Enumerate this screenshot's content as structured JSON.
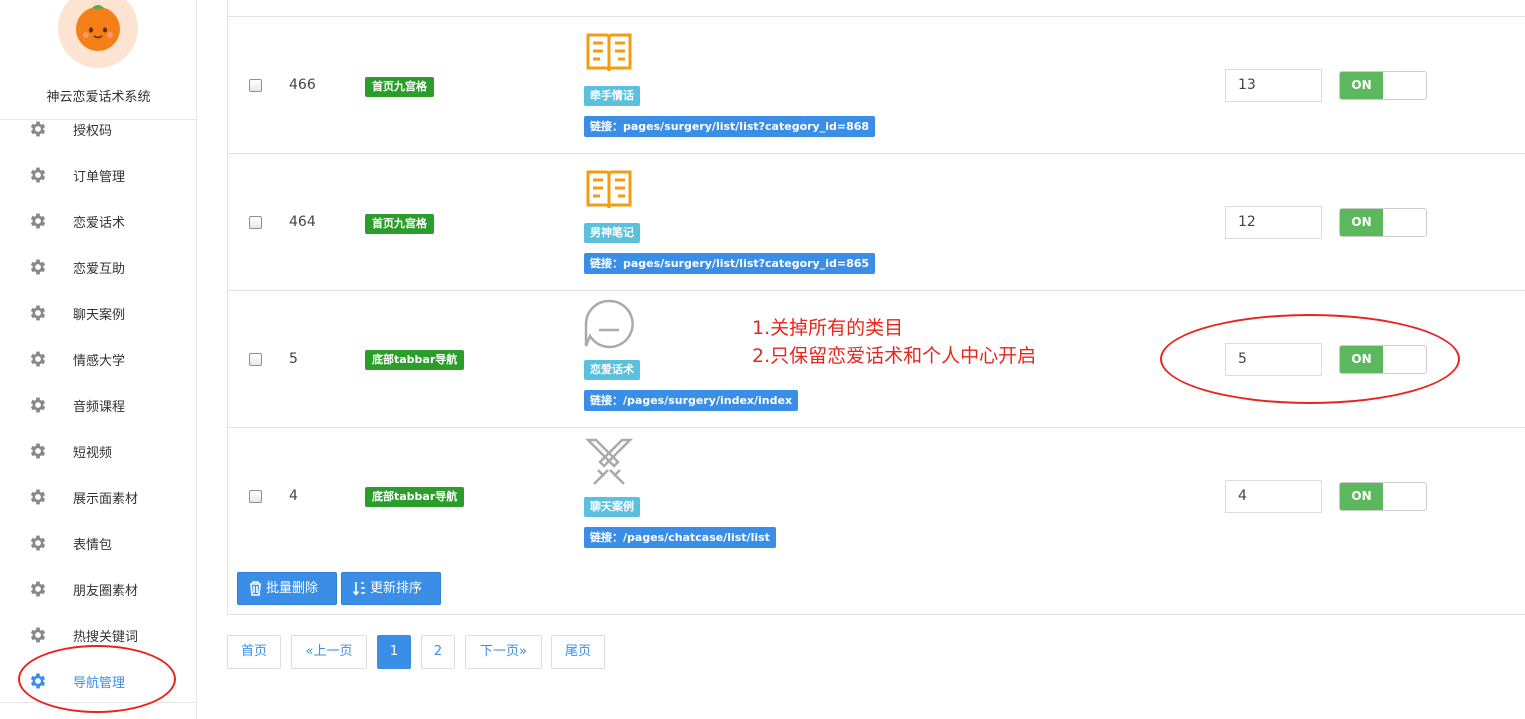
{
  "brand": {
    "name": "神云恋爱话术系统"
  },
  "sidebar": {
    "items": [
      {
        "label": "授权码",
        "icon": "gear-icon"
      },
      {
        "label": "订单管理",
        "icon": "gear-icon"
      },
      {
        "label": "恋爱话术",
        "icon": "gear-icon"
      },
      {
        "label": "恋爱互助",
        "icon": "gear-icon"
      },
      {
        "label": "聊天案例",
        "icon": "gear-icon"
      },
      {
        "label": "情感大学",
        "icon": "gear-icon"
      },
      {
        "label": "音频课程",
        "icon": "gear-icon"
      },
      {
        "label": "短视频",
        "icon": "gear-icon"
      },
      {
        "label": "展示面素材",
        "icon": "gear-icon"
      },
      {
        "label": "表情包",
        "icon": "gear-icon"
      },
      {
        "label": "朋友圈素材",
        "icon": "gear-icon"
      },
      {
        "label": "热搜关键词",
        "icon": "gear-icon"
      },
      {
        "label": "导航管理",
        "icon": "gear-icon",
        "active": true
      }
    ],
    "active_color": "#3a8ee6"
  },
  "table": {
    "rows": [
      {
        "id": "466",
        "type": "首页九宫格",
        "icon": "book-icon",
        "name": "牵手情话",
        "link": "链接：pages/surgery/list/list?category_id=868",
        "sort": "13",
        "switch": "ON"
      },
      {
        "id": "464",
        "type": "首页九宫格",
        "icon": "book-icon",
        "name": "男神笔记",
        "link": "链接：pages/surgery/list/list?category_id=865",
        "sort": "12",
        "switch": "ON"
      },
      {
        "id": "5",
        "type": "底部tabbar导航",
        "icon": "chat-bubble-icon",
        "name": "恋爱话术",
        "link": "链接：/pages/surgery/index/index",
        "sort": "5",
        "switch": "ON"
      },
      {
        "id": "4",
        "type": "底部tabbar导航",
        "icon": "crossed-swords-icon",
        "name": "聊天案例",
        "link": "链接：/pages/chatcase/list/list",
        "sort": "4",
        "switch": "ON"
      }
    ]
  },
  "actions": {
    "batch_delete": "批量删除",
    "update_sort": "更新排序"
  },
  "pagination": {
    "first": "首页",
    "prev": "«上一页",
    "pages": [
      "1",
      "2"
    ],
    "current": "1",
    "next": "下一页»",
    "last": "尾页"
  },
  "annotation": {
    "line1": "1.关掉所有的类目",
    "line2": "2.只保留恋爱话术和个人中心开启",
    "color": "#e8251d"
  },
  "colors": {
    "type_tag": "#2a9d2a",
    "name_tag": "#5bc0de",
    "link_tag": "#3a8ee6",
    "switch_on": "#5cb85c",
    "icon_orange": "#f39c12"
  }
}
